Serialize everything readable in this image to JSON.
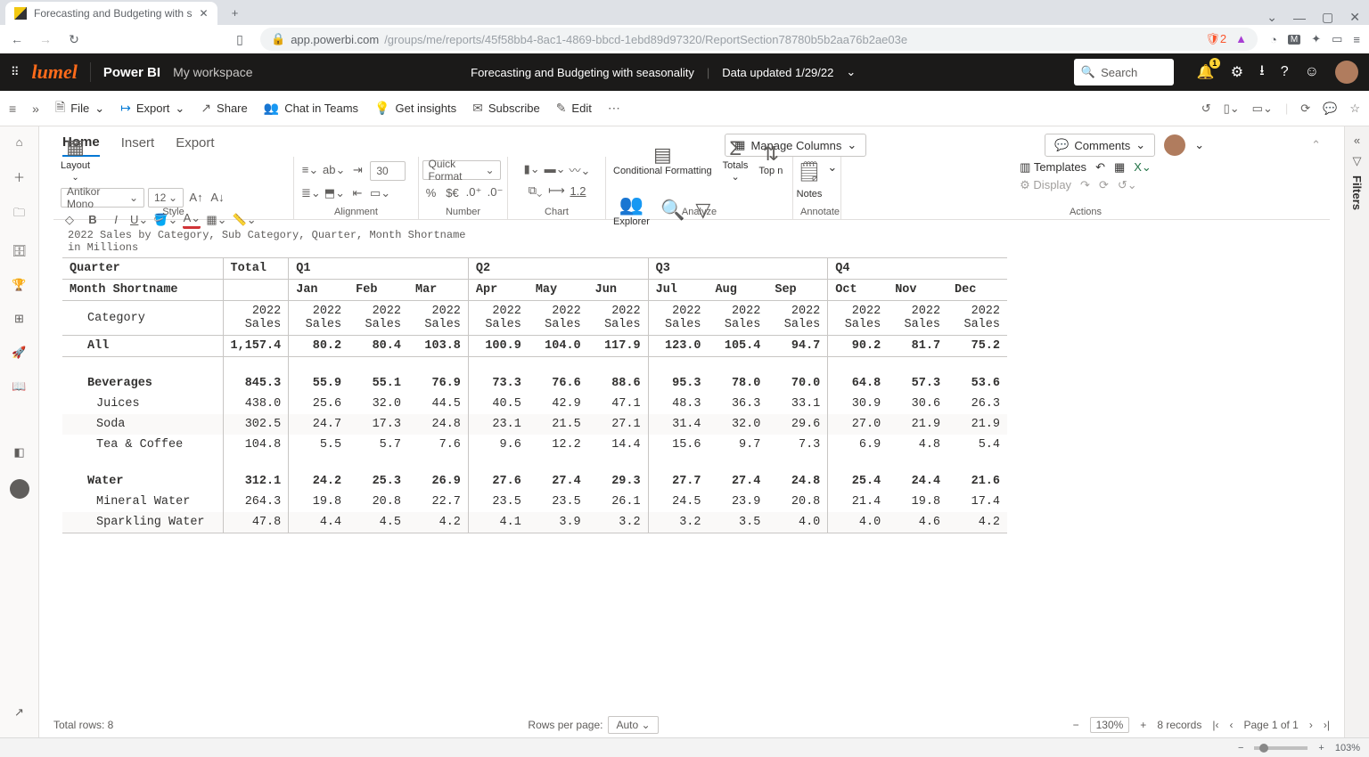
{
  "browser": {
    "tab_title": "Forecasting and Budgeting with s",
    "url_host": "app.powerbi.com",
    "url_path": "/groups/me/reports/45f58bb4-8ac1-4869-bbcd-1ebd89d97320/ReportSection78780b5b2aa76b2ae03e",
    "zoom": "103%"
  },
  "pbi": {
    "product": "Power BI",
    "workspace": "My workspace",
    "report_title": "Forecasting and Budgeting with seasonality",
    "updated": "Data updated 1/29/22",
    "search_placeholder": "Search"
  },
  "toolbar": {
    "file": "File",
    "export": "Export",
    "share": "Share",
    "chat": "Chat in Teams",
    "insights": "Get insights",
    "subscribe": "Subscribe",
    "edit": "Edit"
  },
  "ribbon_tabs": {
    "home": "Home",
    "insert": "Insert",
    "export": "Export"
  },
  "ribbon": {
    "manage_columns": "Manage Columns",
    "comments": "Comments",
    "layout": "Layout",
    "font_name": "Antikor Mono",
    "font_size": "12",
    "spacing_num": "30",
    "quick_format": "Quick Format",
    "conditional_fmt": "Conditional Formatting",
    "totals": "Totals",
    "top_n": "Top n",
    "explorer": "Explorer",
    "notes": "Notes",
    "templates": "Templates",
    "display": "Display",
    "style": "Style",
    "alignment": "Alignment",
    "number": "Number",
    "chart": "Chart",
    "analyze": "Analyze",
    "annotate": "Annotate",
    "actions": "Actions",
    "fmt_underline": "1.2"
  },
  "chart_title_l1": "2022 Sales by Category, Sub Category, Quarter, Month Shortname",
  "chart_title_l2": "in Millions",
  "table": {
    "hdr_quarter": "Quarter",
    "hdr_total": "Total",
    "hdr_q1": "Q1",
    "hdr_q2": "Q2",
    "hdr_q3": "Q3",
    "hdr_q4": "Q4",
    "hdr_month": "Month Shortname",
    "months": [
      "Jan",
      "Feb",
      "Mar",
      "Apr",
      "May",
      "Jun",
      "Jul",
      "Aug",
      "Sep",
      "Oct",
      "Nov",
      "Dec"
    ],
    "hdr_cat": "Category",
    "measure_l1": "2022",
    "measure_l2": "Sales",
    "rows": [
      {
        "label": "All",
        "level": 0,
        "bold": true,
        "values": [
          "1,157.4",
          "80.2",
          "80.4",
          "103.8",
          "100.9",
          "104.0",
          "117.9",
          "123.0",
          "105.4",
          "94.7",
          "90.2",
          "81.7",
          "75.2"
        ]
      },
      {
        "label": "Beverages",
        "level": 1,
        "bold": true,
        "values": [
          "845.3",
          "55.9",
          "55.1",
          "76.9",
          "73.3",
          "76.6",
          "88.6",
          "95.3",
          "78.0",
          "70.0",
          "64.8",
          "57.3",
          "53.6"
        ]
      },
      {
        "label": "Juices",
        "level": 2,
        "values": [
          "438.0",
          "25.6",
          "32.0",
          "44.5",
          "40.5",
          "42.9",
          "47.1",
          "48.3",
          "36.3",
          "33.1",
          "30.9",
          "30.6",
          "26.3"
        ]
      },
      {
        "label": "Soda",
        "level": 2,
        "values": [
          "302.5",
          "24.7",
          "17.3",
          "24.8",
          "23.1",
          "21.5",
          "27.1",
          "31.4",
          "32.0",
          "29.6",
          "27.0",
          "21.9",
          "21.9"
        ]
      },
      {
        "label": "Tea & Coffee",
        "level": 2,
        "values": [
          "104.8",
          "5.5",
          "5.7",
          "7.6",
          "9.6",
          "12.2",
          "14.4",
          "15.6",
          "9.7",
          "7.3",
          "6.9",
          "4.8",
          "5.4"
        ]
      },
      {
        "label": "Water",
        "level": 1,
        "bold": true,
        "values": [
          "312.1",
          "24.2",
          "25.3",
          "26.9",
          "27.6",
          "27.4",
          "29.3",
          "27.7",
          "27.4",
          "24.8",
          "25.4",
          "24.4",
          "21.6"
        ]
      },
      {
        "label": "Mineral Water",
        "level": 2,
        "values": [
          "264.3",
          "19.8",
          "20.8",
          "22.7",
          "23.5",
          "23.5",
          "26.1",
          "24.5",
          "23.9",
          "20.8",
          "21.4",
          "19.8",
          "17.4"
        ]
      },
      {
        "label": "Sparkling Water",
        "level": 2,
        "values": [
          "47.8",
          "4.4",
          "4.5",
          "4.2",
          "4.1",
          "3.9",
          "3.2",
          "3.2",
          "3.5",
          "4.0",
          "4.0",
          "4.6",
          "4.2"
        ]
      }
    ]
  },
  "footer": {
    "total_rows": "Total rows: 8",
    "rpp_label": "Rows per page:",
    "rpp_value": "Auto",
    "zoom": "130%",
    "records": "8 records",
    "page": "Page 1 of 1"
  },
  "filters_label": "Filters",
  "chart_data": {
    "type": "table",
    "title": "2022 Sales by Category, Sub Category, Quarter, Month Shortname (in Millions)",
    "columns": [
      "Category",
      "Total",
      "Jan",
      "Feb",
      "Mar",
      "Apr",
      "May",
      "Jun",
      "Jul",
      "Aug",
      "Sep",
      "Oct",
      "Nov",
      "Dec"
    ],
    "rows": [
      [
        "All",
        1157.4,
        80.2,
        80.4,
        103.8,
        100.9,
        104.0,
        117.9,
        123.0,
        105.4,
        94.7,
        90.2,
        81.7,
        75.2
      ],
      [
        "Beverages",
        845.3,
        55.9,
        55.1,
        76.9,
        73.3,
        76.6,
        88.6,
        95.3,
        78.0,
        70.0,
        64.8,
        57.3,
        53.6
      ],
      [
        "Juices",
        438.0,
        25.6,
        32.0,
        44.5,
        40.5,
        42.9,
        47.1,
        48.3,
        36.3,
        33.1,
        30.9,
        30.6,
        26.3
      ],
      [
        "Soda",
        302.5,
        24.7,
        17.3,
        24.8,
        23.1,
        21.5,
        27.1,
        31.4,
        32.0,
        29.6,
        27.0,
        21.9,
        21.9
      ],
      [
        "Tea & Coffee",
        104.8,
        5.5,
        5.7,
        7.6,
        9.6,
        12.2,
        14.4,
        15.6,
        9.7,
        7.3,
        6.9,
        4.8,
        5.4
      ],
      [
        "Water",
        312.1,
        24.2,
        25.3,
        26.9,
        27.6,
        27.4,
        29.3,
        27.7,
        27.4,
        24.8,
        25.4,
        24.4,
        21.6
      ],
      [
        "Mineral Water",
        264.3,
        19.8,
        20.8,
        22.7,
        23.5,
        23.5,
        26.1,
        24.5,
        23.9,
        20.8,
        21.4,
        19.8,
        17.4
      ],
      [
        "Sparkling Water",
        47.8,
        4.4,
        4.5,
        4.2,
        4.1,
        3.9,
        3.2,
        3.2,
        3.5,
        4.0,
        4.0,
        4.6,
        4.2
      ]
    ]
  }
}
